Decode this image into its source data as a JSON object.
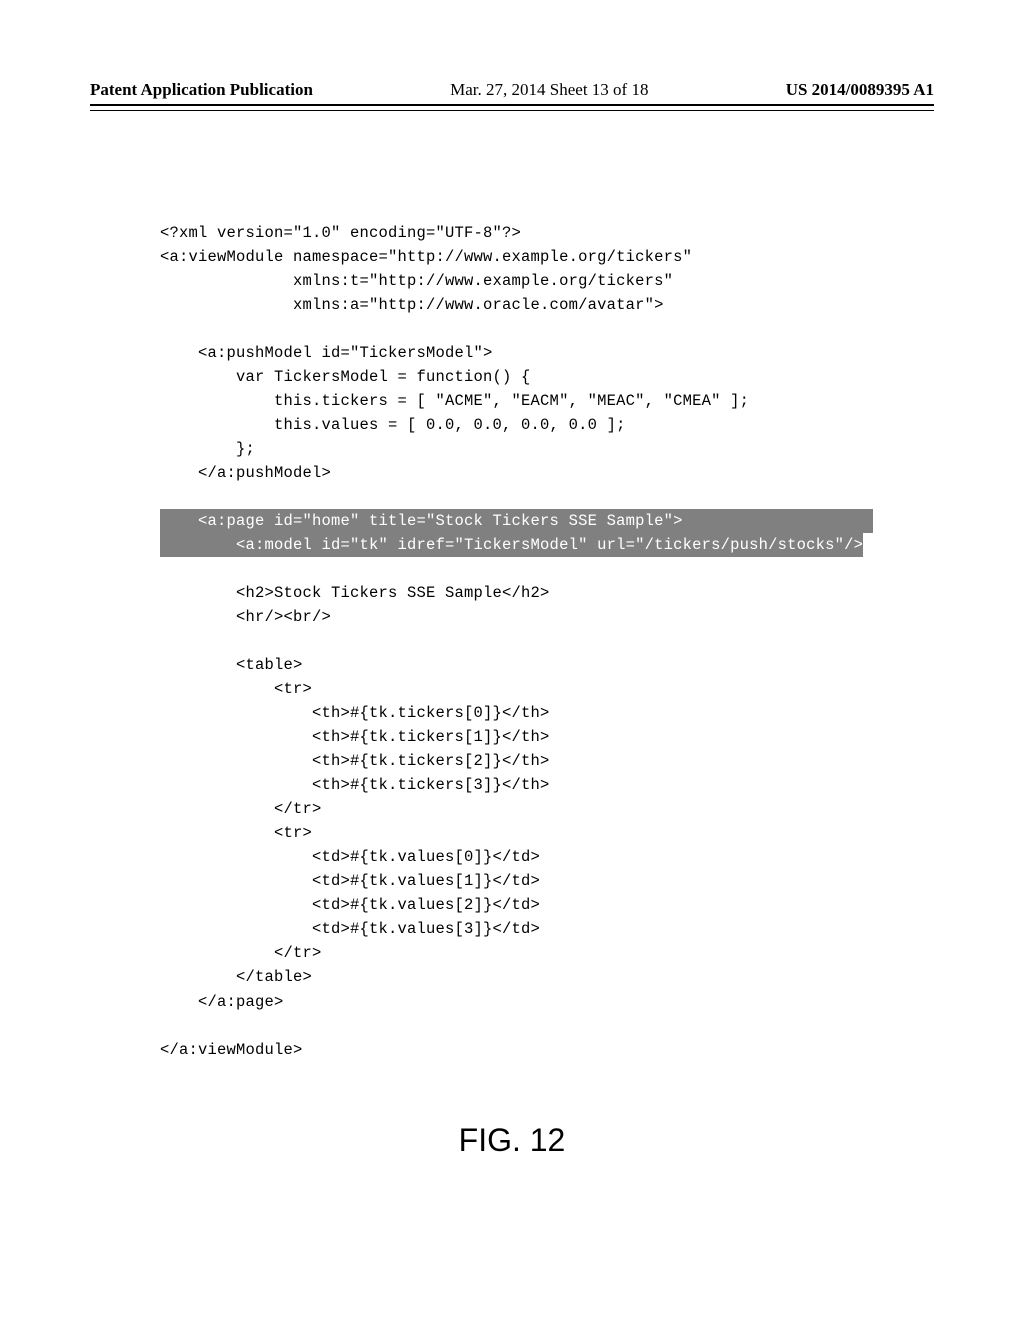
{
  "header": {
    "left": "Patent Application Publication",
    "mid": "Mar. 27, 2014  Sheet 13 of 18",
    "right": "US 2014/0089395 A1"
  },
  "code": {
    "l01": "<?xml version=\"1.0\" encoding=\"UTF-8\"?>",
    "l02": "<a:viewModule namespace=\"http://www.example.org/tickers\"",
    "l03": "              xmlns:t=\"http://www.example.org/tickers\"",
    "l04": "              xmlns:a=\"http://www.oracle.com/avatar\">",
    "l05": "",
    "l06": "    <a:pushModel id=\"TickersModel\">",
    "l07": "        var TickersModel = function() {",
    "l08": "            this.tickers = [ \"ACME\", \"EACM\", \"MEAC\", \"CMEA\" ];",
    "l09": "            this.values = [ 0.0, 0.0, 0.0, 0.0 ];",
    "l10": "        };",
    "l11": "    </a:pushModel>",
    "l12": "",
    "h1": "    <a:page id=\"home\" title=\"Stock Tickers SSE Sample\">                    ",
    "h2": "        <a:model id=\"tk\" idref=\"TickersModel\" url=\"/tickers/push/stocks\"/>",
    "l15": "",
    "l16": "        <h2>Stock Tickers SSE Sample</h2>",
    "l17": "        <hr/><br/>",
    "l18": "",
    "l19": "        <table>",
    "l20": "            <tr>",
    "l21": "                <th>#{tk.tickers[0]}</th>",
    "l22": "                <th>#{tk.tickers[1]}</th>",
    "l23": "                <th>#{tk.tickers[2]}</th>",
    "l24": "                <th>#{tk.tickers[3]}</th>",
    "l25": "            </tr>",
    "l26": "            <tr>",
    "l27": "                <td>#{tk.values[0]}</td>",
    "l28": "                <td>#{tk.values[1]}</td>",
    "l29": "                <td>#{tk.values[2]}</td>",
    "l30": "                <td>#{tk.values[3]}</td>",
    "l31": "            </tr>",
    "l32": "        </table>",
    "l33": "    </a:page>",
    "l34": "",
    "l35": "</a:viewModule>"
  },
  "figure_label": "FIG. 12"
}
